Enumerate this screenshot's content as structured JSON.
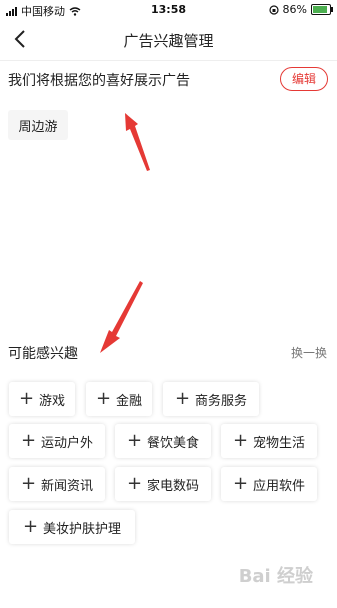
{
  "status_bar": {
    "carrier": "中国移动",
    "time": "13:58",
    "battery": "86%",
    "battery_level": 0.86
  },
  "header": {
    "title": "广告兴趣管理"
  },
  "my_interests": {
    "heading": "我们将根据您的喜好展示广告",
    "edit_label": "编辑",
    "items": [
      {
        "label": "周边游"
      }
    ]
  },
  "possible_interests": {
    "heading": "可能感兴趣",
    "refresh_label": "换一换",
    "items": [
      {
        "label": "游戏"
      },
      {
        "label": "金融"
      },
      {
        "label": "商务服务"
      },
      {
        "label": "运动户外"
      },
      {
        "label": "餐饮美食"
      },
      {
        "label": "宠物生活"
      },
      {
        "label": "新闻资讯"
      },
      {
        "label": "家电数码"
      },
      {
        "label": "应用软件"
      },
      {
        "label": "美妆护肤护理"
      }
    ],
    "add_icon": "plus-icon"
  },
  "watermark": {
    "text": "Bai 经验"
  },
  "colors": {
    "accent": "#e53935",
    "annotation_arrow": "#e53935",
    "chip_bg": "#f5f5f5"
  }
}
